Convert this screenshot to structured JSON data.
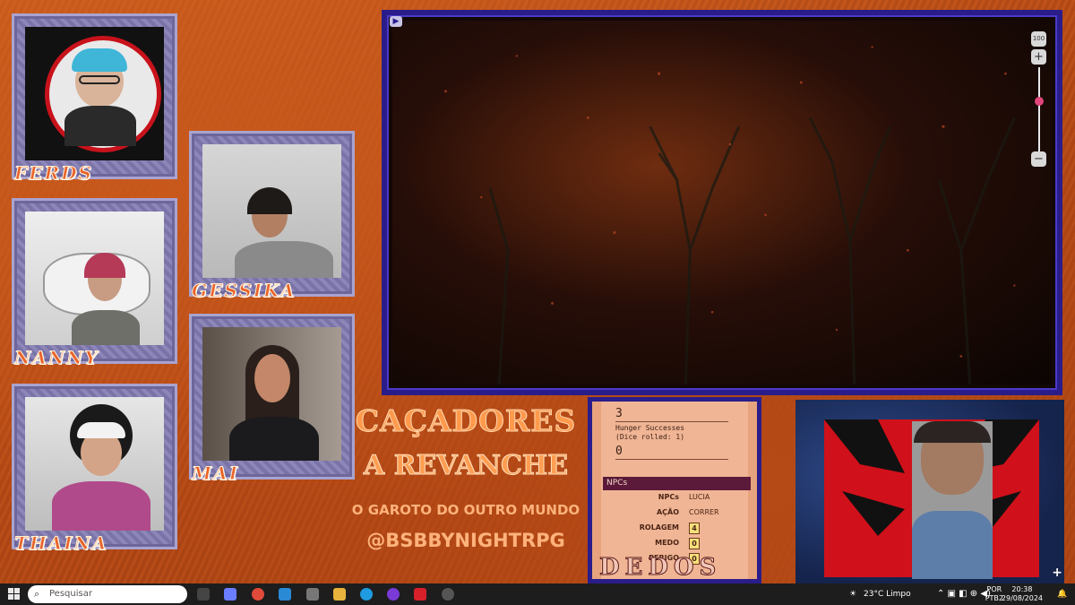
{
  "participants": [
    {
      "name": "FERDS"
    },
    {
      "name": "GESSIKA"
    },
    {
      "name": "NANNY"
    },
    {
      "name": "MAI"
    },
    {
      "name": "THAINA"
    }
  ],
  "main_stage": {
    "zoom_value": "100",
    "zoom_in": "+",
    "zoom_out": "−",
    "zoom_level": 0.6
  },
  "titles": {
    "line1": "CAÇADORES",
    "line2": "A REVANCHE",
    "line3": "O GAROTO DO OUTRO MUNDO",
    "line4": "@BSBBYNIGHTRPG"
  },
  "dice_panel": {
    "top_value": "3",
    "label_line1": "Hunger Successes",
    "label_line2": "(Dice rolled: 1)",
    "bottom_value": "0",
    "npc_header": "NPCs",
    "npc_rows": [
      {
        "key": "NPCs",
        "value": "LUCIA"
      },
      {
        "key": "AÇÃO",
        "value": "CORRER"
      },
      {
        "key": "ROLAGEM",
        "value": "4"
      },
      {
        "key": "MEDO",
        "value": "0"
      },
      {
        "key": "PERIGO",
        "value": "0"
      }
    ],
    "footer": "DEDOS"
  },
  "taskbar": {
    "search_placeholder": "Pesquisar",
    "weather": "23°C  Limpo",
    "lang1": "POR",
    "lang2": "PTB2",
    "time": "20:38",
    "date": "29/08/2024"
  },
  "colors": {
    "accent_blue": "#2a1d8a",
    "name_orange": "#e9632a"
  }
}
